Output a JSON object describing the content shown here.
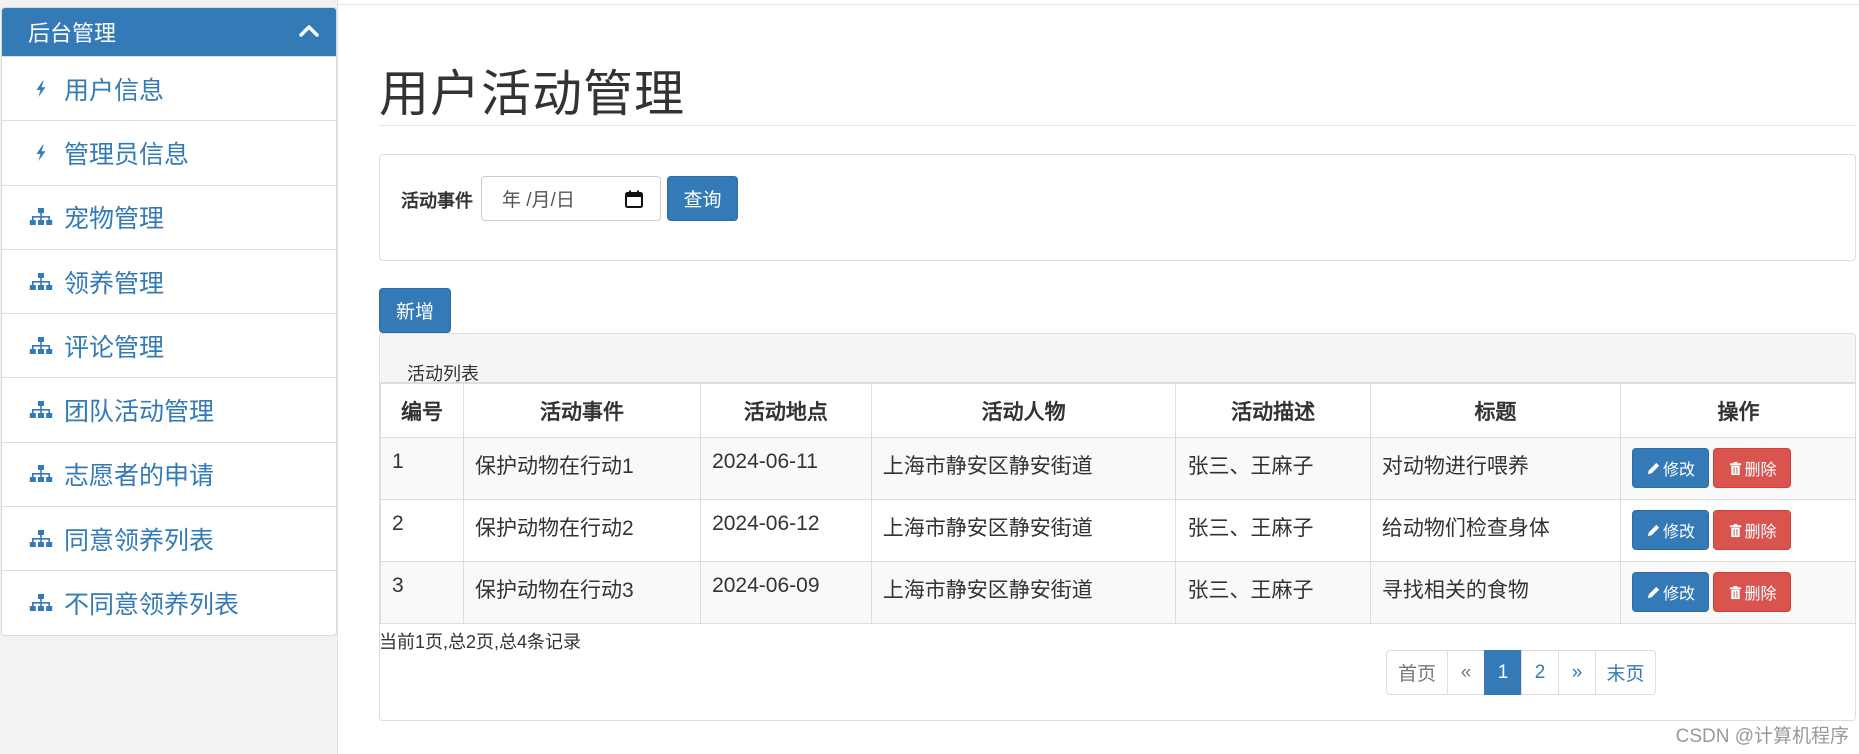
{
  "sidebar": {
    "header": "后台管理",
    "items": [
      {
        "label": "用户信息",
        "icon": "bolt-icon"
      },
      {
        "label": "管理员信息",
        "icon": "bolt-icon"
      },
      {
        "label": "宠物管理",
        "icon": "sitemap-icon"
      },
      {
        "label": "领养管理",
        "icon": "sitemap-icon"
      },
      {
        "label": "评论管理",
        "icon": "sitemap-icon"
      },
      {
        "label": "团队活动管理",
        "icon": "sitemap-icon"
      },
      {
        "label": "志愿者的申请",
        "icon": "sitemap-icon"
      },
      {
        "label": "同意领养列表",
        "icon": "sitemap-icon"
      },
      {
        "label": "不同意领养列表",
        "icon": "sitemap-icon"
      }
    ]
  },
  "main": {
    "title": "用户活动管理",
    "search": {
      "label": "活动事件",
      "date_placeholder": "年 /月/日",
      "button": "查询"
    },
    "add_button": "新增",
    "panel_title": "活动列表",
    "table": {
      "headers": [
        "编号",
        "活动事件",
        "活动地点",
        "活动人物",
        "活动描述",
        "标题",
        "操作"
      ],
      "rows": [
        [
          "1",
          "保护动物在行动1",
          "2024-06-11",
          "上海市静安区静安街道",
          "张三、王麻子",
          "对动物进行喂养"
        ],
        [
          "2",
          "保护动物在行动2",
          "2024-06-12",
          "上海市静安区静安街道",
          "张三、王麻子",
          "给动物们检查身体"
        ],
        [
          "3",
          "保护动物在行动3",
          "2024-06-09",
          "上海市静安区静安街道",
          "张三、王麻子",
          "寻找相关的食物"
        ]
      ],
      "edit_label": "修改",
      "delete_label": "删除"
    },
    "record_info": "当前1页,总2页,总4条记录",
    "pagination": {
      "first": "首页",
      "prev": "«",
      "pages": [
        "1",
        "2"
      ],
      "current": "1",
      "next": "»",
      "last": "末页"
    }
  },
  "watermark": "CSDN @计算机程序",
  "colors": {
    "primary": "#337ab7",
    "danger": "#d9534f"
  }
}
